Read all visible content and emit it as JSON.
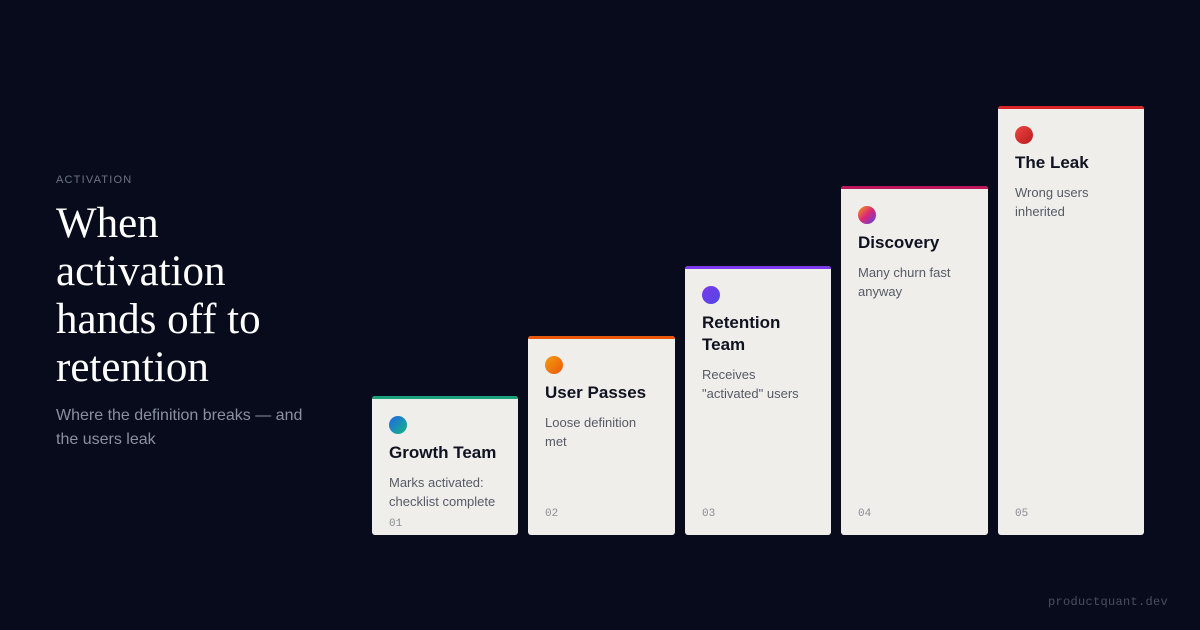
{
  "header": {
    "eyebrow": "ACTIVATION",
    "title": "When activation hands off to retention",
    "subtitle": "Where the definition breaks — and the users leak"
  },
  "steps": [
    {
      "name": "Growth Team",
      "desc": "Marks activated: checklist complete",
      "num": "01",
      "color": "#1aa37a",
      "dot": "linear-gradient(135deg,#2563eb,#10b981)"
    },
    {
      "name": "User Passes",
      "desc": "Loose definition met",
      "num": "02",
      "color": "#ea580c",
      "dot": "linear-gradient(135deg,#f59e0b,#ea580c)"
    },
    {
      "name": "Retention Team",
      "desc": "Receives \"activated\" users",
      "num": "03",
      "color": "#7c3aed",
      "dot": "linear-gradient(135deg,#7c3aed,#4f46e5)"
    },
    {
      "name": "Discovery",
      "desc": "Many churn fast anyway",
      "num": "04",
      "color": "#be185d",
      "dot": "linear-gradient(135deg,#f59e0b,#db2777,#4f46e5)"
    },
    {
      "name": "The Leak",
      "desc": "Wrong users inherited",
      "num": "05",
      "color": "#dc2626",
      "dot": "linear-gradient(135deg,#ef4444,#b91c1c)"
    }
  ],
  "footer": "productquant.dev"
}
